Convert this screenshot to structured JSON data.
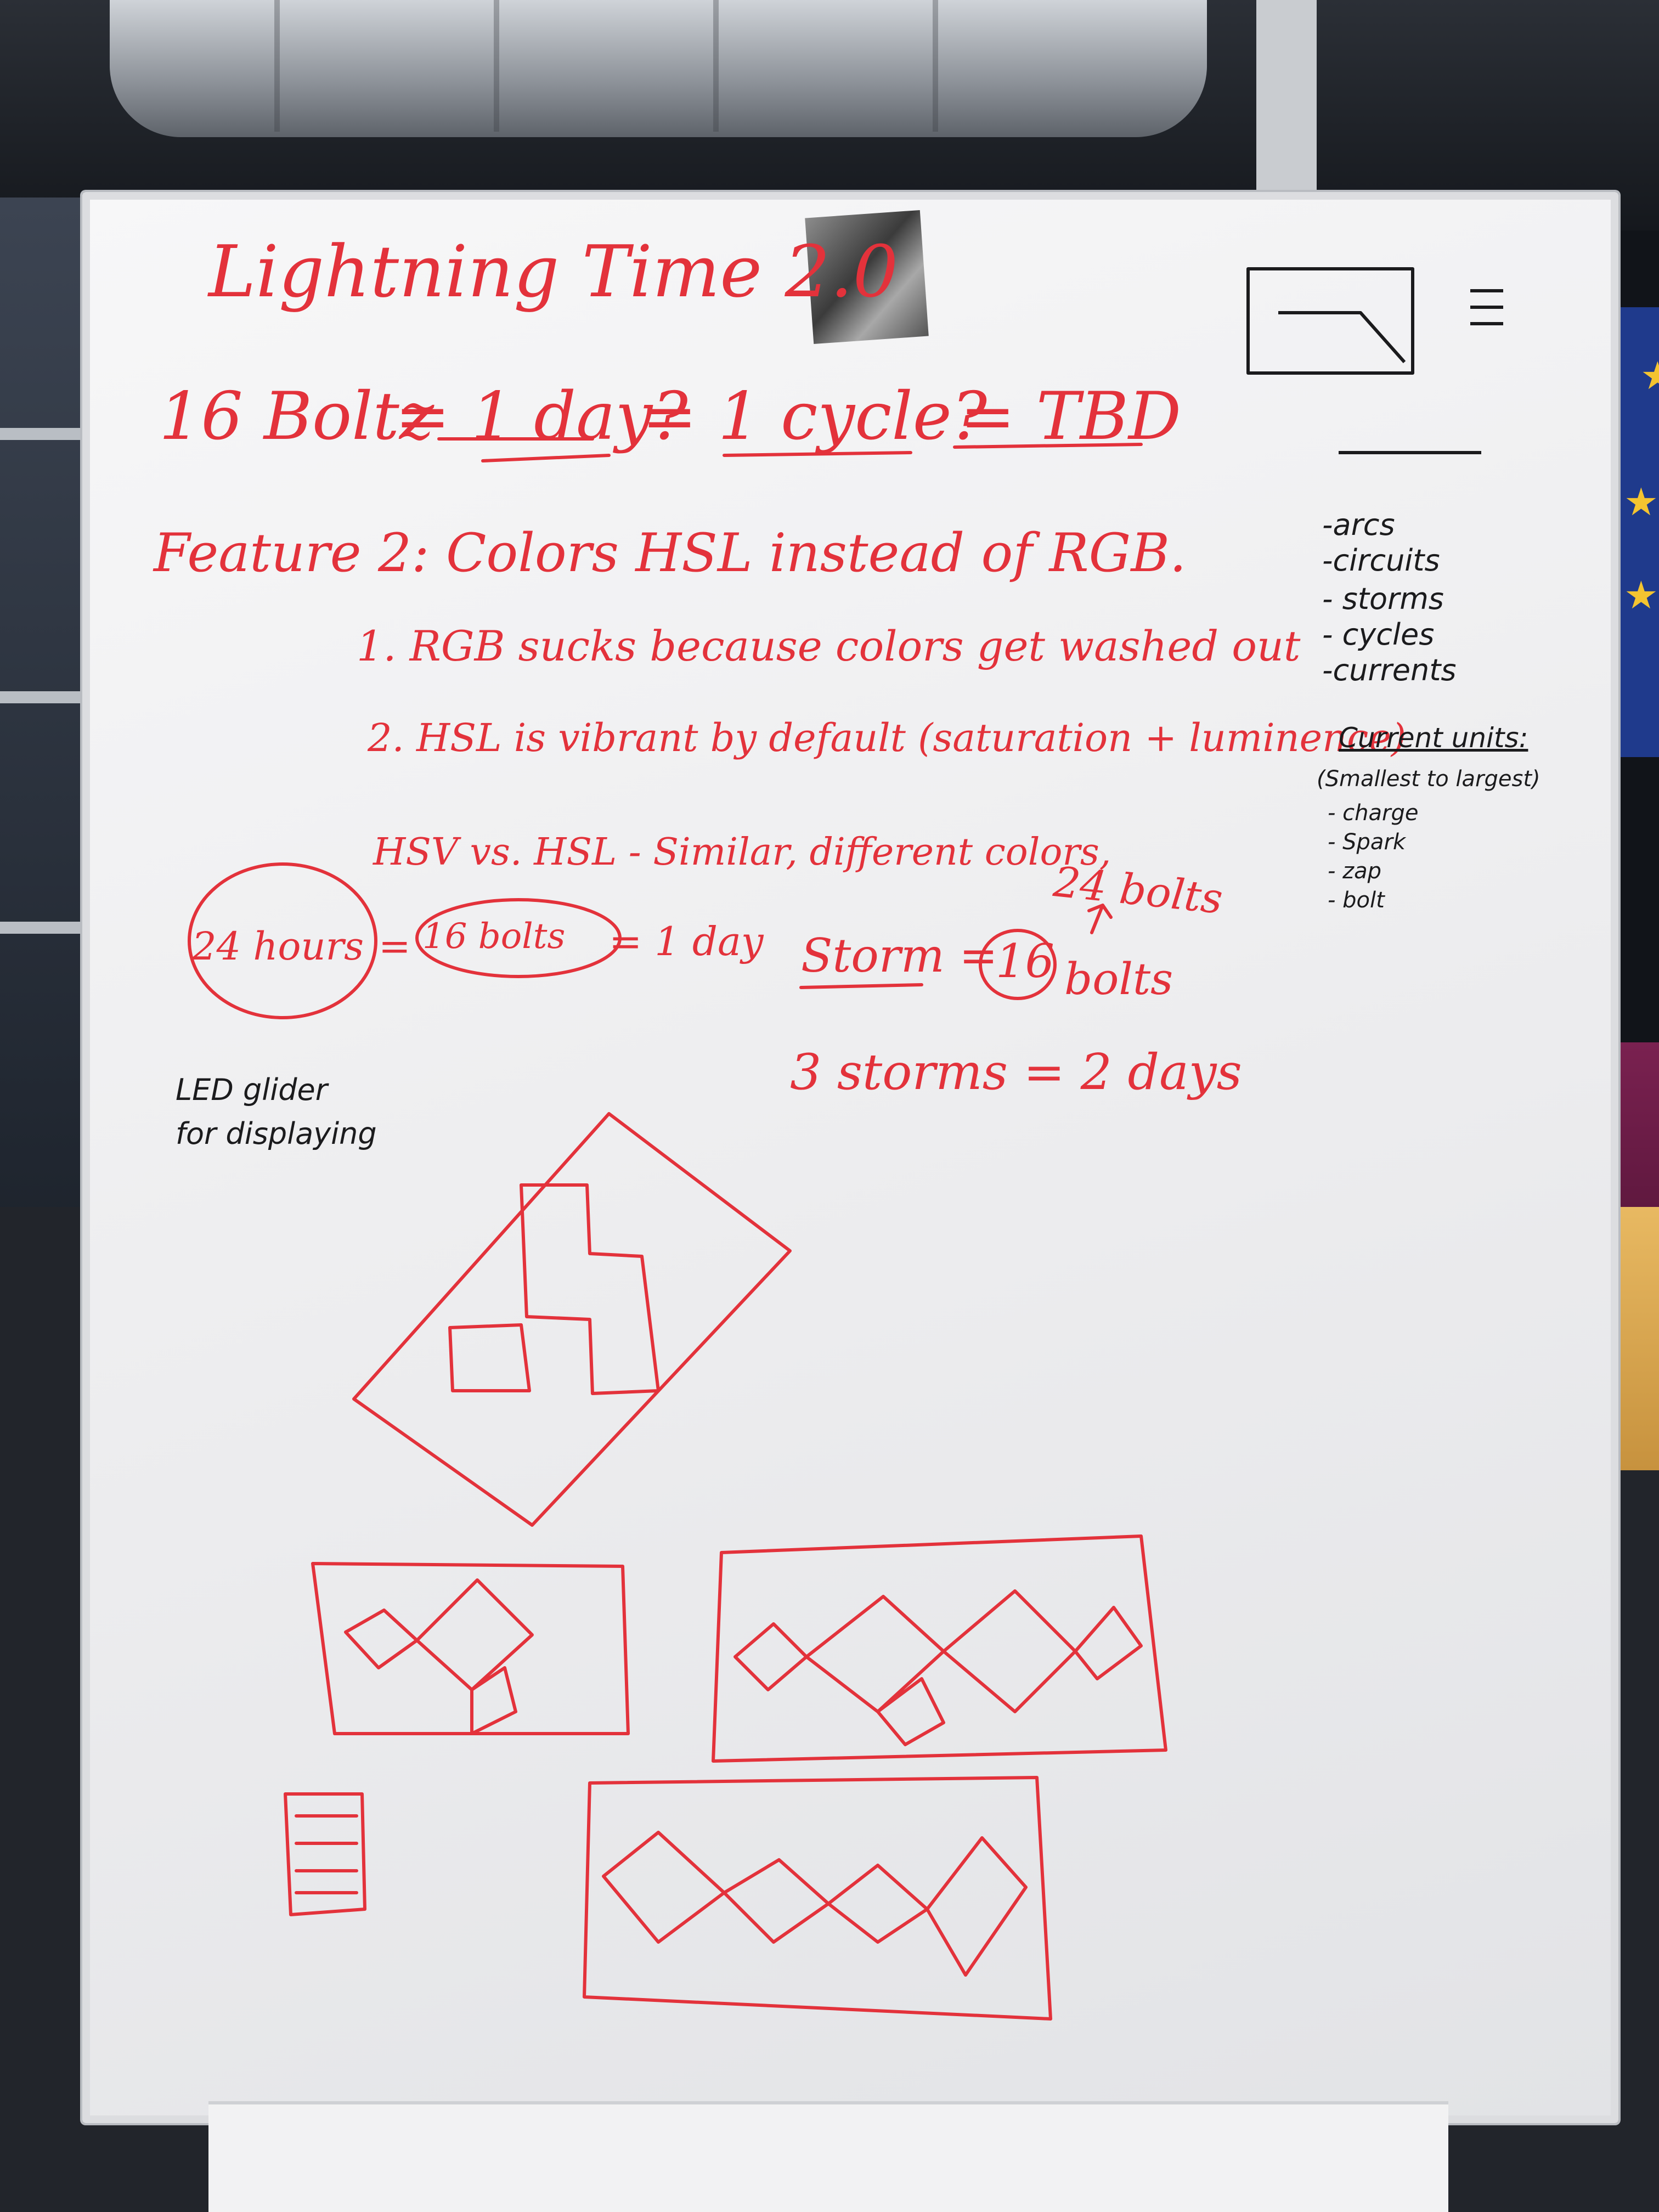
{
  "board": {
    "title": "Lightning Time 2.0",
    "equation": {
      "part1": "16 Boltz",
      "part2": "= 1 day?",
      "part3": "= 1 cycle?",
      "part4": "= TBD"
    },
    "feature": "Feature 2: Colors HSL instead of RGB.",
    "point1": "1. RGB sucks because colors get washed out",
    "point2": "2. HSL is vibrant by default (saturation + luminence)",
    "hsv_note": "HSV vs. HSL - Similar, different colors,",
    "conversion": {
      "hours": "24 hours",
      "equals1": "=",
      "bolts": "16 bolts",
      "equals2": "= 1 day"
    },
    "storm": {
      "label": "Storm =",
      "number": "16",
      "unit": "bolts",
      "correction": "24 bolts"
    },
    "storms_days": "3 storms = 2 days",
    "led_note": {
      "line1": "LED glider",
      "line2": "for displaying"
    },
    "side_list": [
      "-arcs",
      "-circuits",
      "- storms",
      "- cycles",
      "-currents"
    ],
    "current_units": {
      "title": "Current units:",
      "subtitle": "(Smallest to largest)",
      "items": [
        "- charge",
        "- Spark",
        "- zap",
        "- bolt"
      ]
    }
  },
  "colors": {
    "red_marker": "#e3323b",
    "black_marker": "#1b1b1d",
    "board": "#f2f2f3"
  }
}
